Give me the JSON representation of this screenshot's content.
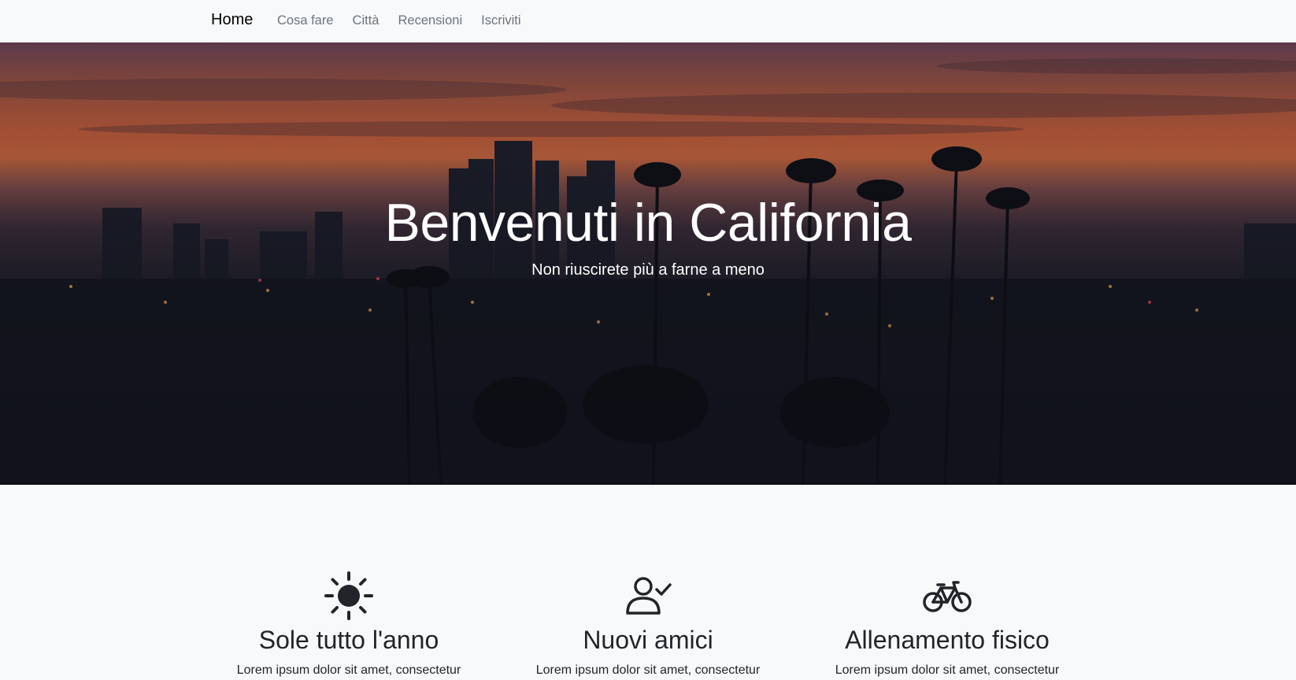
{
  "nav": {
    "brand": "Home",
    "links": [
      "Cosa fare",
      "Città",
      "Recensioni",
      "Iscriviti"
    ]
  },
  "hero": {
    "title": "Benvenuti in California",
    "subtitle": "Non riuscirete più a farne a meno"
  },
  "features": [
    {
      "icon": "sun-icon",
      "title": "Sole tutto l'anno",
      "text": "Lorem ipsum dolor sit amet, consectetur"
    },
    {
      "icon": "person-check-icon",
      "title": "Nuovi amici",
      "text": "Lorem ipsum dolor sit amet, consectetur"
    },
    {
      "icon": "bicycle-icon",
      "title": "Allenamento fisico",
      "text": "Lorem ipsum dolor sit amet, consectetur"
    }
  ],
  "colors": {
    "background": "#f8f9fa",
    "text": "#212529",
    "nav_link": "#6c757d",
    "hero_text": "#ffffff"
  }
}
